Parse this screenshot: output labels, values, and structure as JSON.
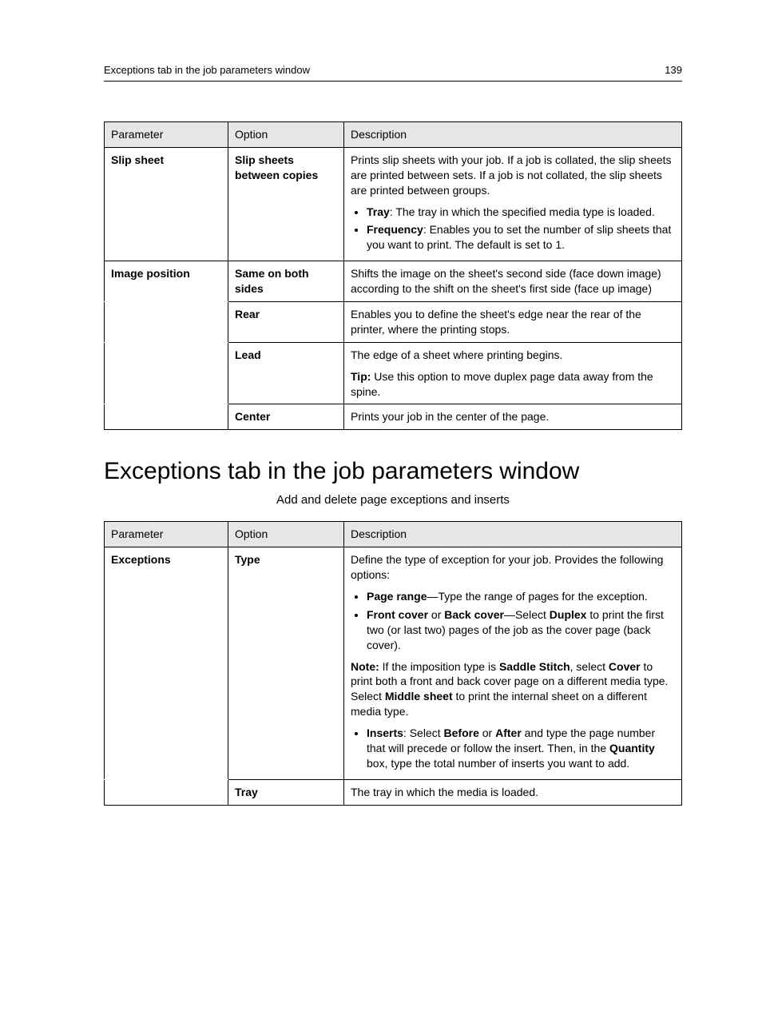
{
  "header": {
    "title": "Exceptions tab in the job parameters window",
    "page_number": "139"
  },
  "table1": {
    "headers": {
      "c1": "Parameter",
      "c2": "Option",
      "c3": "Description"
    },
    "slip_sheet": {
      "param": "Slip sheet",
      "option": "Slip sheets between copies",
      "intro": "Prints slip sheets with your job. If a job is collated, the slip sheets are printed between sets. If a job is not collated, the slip sheets are printed between groups.",
      "bullet_tray_label": "Tray",
      "bullet_tray_text": ": The tray in which the specified media type is loaded.",
      "bullet_freq_label": "Frequency",
      "bullet_freq_text": ": Enables you to set the number of slip sheets that you want to print. The default is set to 1."
    },
    "image_position": {
      "param": "Image position",
      "same": {
        "option": "Same on both sides",
        "desc": "Shifts the image on the sheet's second side (face down image) according to the shift on the sheet's first side (face up image)"
      },
      "rear": {
        "option": "Rear",
        "desc": "Enables you to define the sheet's edge near the rear of the printer, where the printing stops."
      },
      "lead": {
        "option": "Lead",
        "desc1": "The edge of a sheet where printing begins.",
        "tip_label": "Tip:",
        "tip_text": " Use this option to move duplex page data away from the spine."
      },
      "center": {
        "option": "Center",
        "desc": "Prints your job in the center of the page."
      }
    }
  },
  "section": {
    "heading": "Exceptions tab in the job parameters window",
    "subtitle": "Add and delete page exceptions and inserts"
  },
  "table2": {
    "headers": {
      "c1": "Parameter",
      "c2": "Option",
      "c3": "Description"
    },
    "exceptions": {
      "param": "Exceptions",
      "type": {
        "option": "Type",
        "intro": "Define the type of exception for your job. Provides the following options:",
        "b_page_range_label": "Page range",
        "b_page_range_text": "—Type the range of pages for the exception.",
        "b_front_label": "Front cover",
        "b_or": " or ",
        "b_back_label": "Back cover",
        "b_select": "—Select ",
        "b_duplex": "Duplex",
        "b_cover_text": " to print the first two (or last two) pages of the job as the cover page (back cover).",
        "note_label": "Note:",
        "note_text1": " If the imposition type is ",
        "note_saddle": "Saddle Stitch",
        "note_text2": ", select ",
        "note_cover": "Cover",
        "note_text3": " to print both a front and back cover page on a different media type. Select ",
        "note_middle": "Middle sheet",
        "note_text4": " to print the internal sheet on a different media type.",
        "b_inserts_label": "Inserts",
        "b_inserts_select": ": Select ",
        "b_before": "Before",
        "b_or2": " or ",
        "b_after": "After",
        "b_inserts_text1": " and type the page number that will precede or follow the insert. Then, in the ",
        "b_quantity": "Quantity",
        "b_inserts_text2": " box, type the total number of inserts you want to add."
      },
      "tray": {
        "option": "Tray",
        "desc": "The tray in which the media is loaded."
      }
    }
  }
}
